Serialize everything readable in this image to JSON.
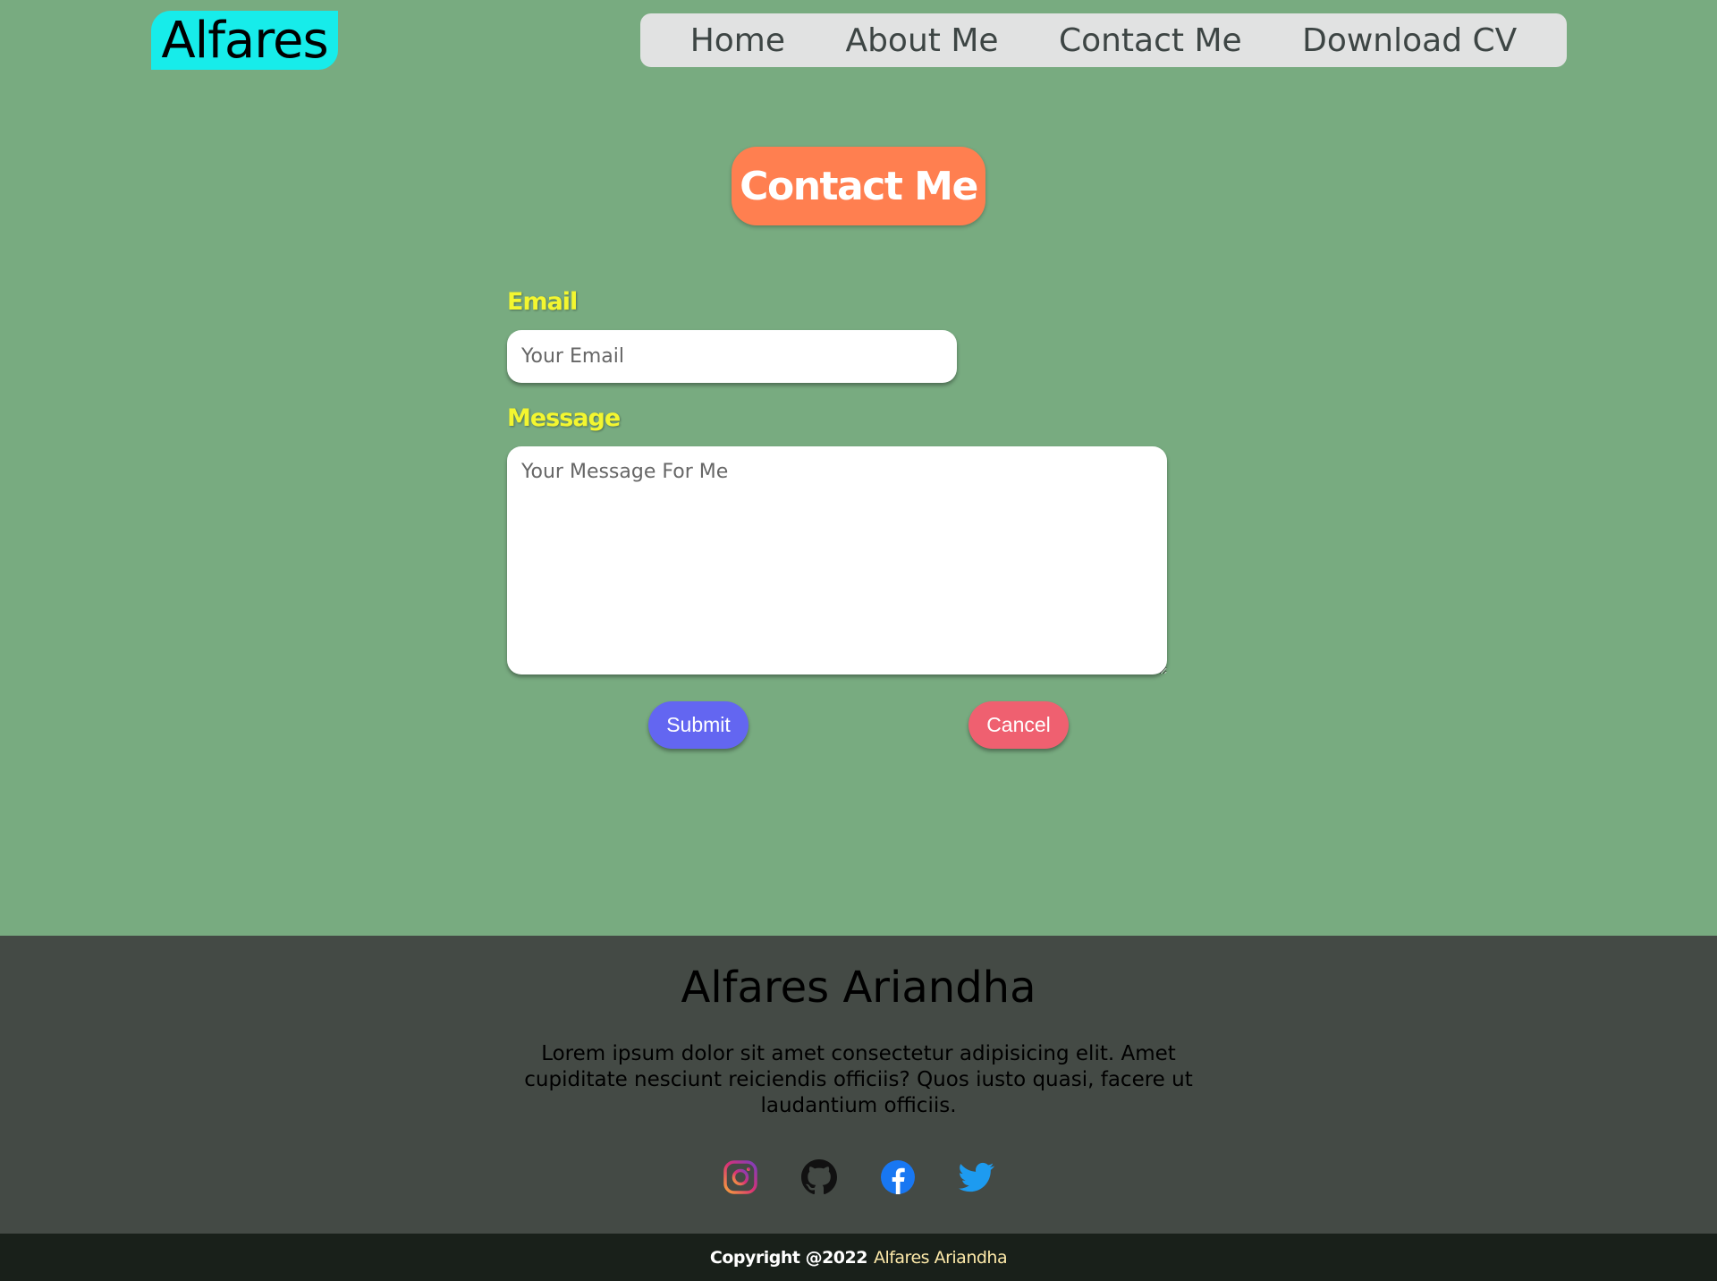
{
  "header": {
    "logo": "Alfares",
    "nav": [
      "Home",
      "About Me",
      "Contact Me",
      "Download CV"
    ]
  },
  "main": {
    "title": "Contact Me",
    "email_label": "Email",
    "email_placeholder": "Your Email",
    "message_label": "Message",
    "message_placeholder": "Your Message For Me",
    "submit_label": "Submit",
    "cancel_label": "Cancel"
  },
  "footer": {
    "name": "Alfares Ariandha",
    "text": "Lorem ipsum dolor sit amet consectetur adipisicing elit. Amet cupiditate nesciunt reiciendis officiis? Quos iusto quasi, facere ut laudantium officiis.",
    "socials": [
      "instagram-icon",
      "github-icon",
      "facebook-icon",
      "twitter-icon"
    ],
    "copyright_prefix": "Copyright @2022",
    "copyright_owner": "Alfares Ariandha"
  },
  "colors": {
    "page_bg": "#78ab80",
    "logo_bg": "#17ecea",
    "nav_bg": "#e1e2e2",
    "title_bg": "#ff7f50",
    "label": "#f3f630",
    "submit": "#6366f1",
    "cancel": "#ef6070",
    "footer_bg": "#444a45",
    "copyright_bg": "#19201a"
  }
}
